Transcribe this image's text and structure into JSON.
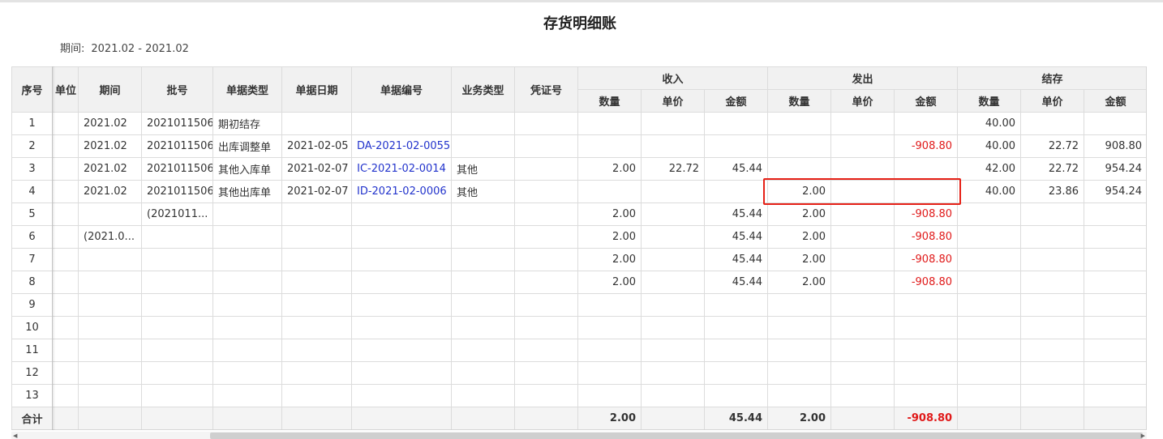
{
  "title": "存货明细账",
  "period": {
    "label": "期间:",
    "value": "2021.02 - 2021.02"
  },
  "headers": {
    "seq": "序号",
    "unit_partial": "单位",
    "period": "期间",
    "batch": "批号",
    "doc_type": "单据类型",
    "doc_date": "单据日期",
    "doc_no": "单据编号",
    "biz_type": "业务类型",
    "voucher": "凭证号",
    "in_group": "收入",
    "out_group": "发出",
    "bal_group": "结存",
    "qty": "数量",
    "price": "单价",
    "amount": "金额"
  },
  "rows": [
    {
      "seq": "1",
      "period": "2021.02",
      "batch": "2021011506",
      "doc_type": "期初结存",
      "doc_date": "",
      "doc_no": "",
      "biz_type": "",
      "voucher": "",
      "in_qty": "",
      "in_price": "",
      "in_amt": "",
      "out_qty": "",
      "out_price": "",
      "out_amt": "",
      "bal_qty": "40.00",
      "bal_price": "",
      "bal_amt": ""
    },
    {
      "seq": "2",
      "period": "2021.02",
      "batch": "2021011506",
      "doc_type": "出库调整单",
      "doc_date": "2021-02-05",
      "doc_no": "DA-2021-02-0055",
      "biz_type": "",
      "voucher": "",
      "in_qty": "",
      "in_price": "",
      "in_amt": "",
      "out_qty": "",
      "out_price": "",
      "out_amt": "-908.80",
      "bal_qty": "40.00",
      "bal_price": "22.72",
      "bal_amt": "908.80"
    },
    {
      "seq": "3",
      "period": "2021.02",
      "batch": "2021011506",
      "doc_type": "其他入库单",
      "doc_date": "2021-02-07",
      "doc_no": "IC-2021-02-0014",
      "biz_type": "其他",
      "voucher": "",
      "in_qty": "2.00",
      "in_price": "22.72",
      "in_amt": "45.44",
      "out_qty": "",
      "out_price": "",
      "out_amt": "",
      "bal_qty": "42.00",
      "bal_price": "22.72",
      "bal_amt": "954.24"
    },
    {
      "seq": "4",
      "period": "2021.02",
      "batch": "2021011506",
      "doc_type": "其他出库单",
      "doc_date": "2021-02-07",
      "doc_no": "ID-2021-02-0006",
      "biz_type": "其他",
      "voucher": "",
      "in_qty": "",
      "in_price": "",
      "in_amt": "",
      "out_qty": "2.00",
      "out_price": "",
      "out_amt": "",
      "bal_qty": "40.00",
      "bal_price": "23.86",
      "bal_amt": "954.24"
    },
    {
      "seq": "5",
      "period": "",
      "batch": "(2021011...",
      "doc_type": "",
      "doc_date": "",
      "doc_no": "",
      "biz_type": "",
      "voucher": "",
      "in_qty": "2.00",
      "in_price": "",
      "in_amt": "45.44",
      "out_qty": "2.00",
      "out_price": "",
      "out_amt": "-908.80",
      "bal_qty": "",
      "bal_price": "",
      "bal_amt": ""
    },
    {
      "seq": "6",
      "period": "(2021.0...",
      "batch": "",
      "doc_type": "",
      "doc_date": "",
      "doc_no": "",
      "biz_type": "",
      "voucher": "",
      "in_qty": "2.00",
      "in_price": "",
      "in_amt": "45.44",
      "out_qty": "2.00",
      "out_price": "",
      "out_amt": "-908.80",
      "bal_qty": "",
      "bal_price": "",
      "bal_amt": ""
    },
    {
      "seq": "7",
      "period": "",
      "batch": "",
      "doc_type": "",
      "doc_date": "",
      "doc_no": "",
      "biz_type": "",
      "voucher": "",
      "in_qty": "2.00",
      "in_price": "",
      "in_amt": "45.44",
      "out_qty": "2.00",
      "out_price": "",
      "out_amt": "-908.80",
      "bal_qty": "",
      "bal_price": "",
      "bal_amt": ""
    },
    {
      "seq": "8",
      "period": "",
      "batch": "",
      "doc_type": "",
      "doc_date": "",
      "doc_no": "",
      "biz_type": "",
      "voucher": "",
      "in_qty": "2.00",
      "in_price": "",
      "in_amt": "45.44",
      "out_qty": "2.00",
      "out_price": "",
      "out_amt": "-908.80",
      "bal_qty": "",
      "bal_price": "",
      "bal_amt": ""
    },
    {
      "seq": "9"
    },
    {
      "seq": "10"
    },
    {
      "seq": "11"
    },
    {
      "seq": "12"
    },
    {
      "seq": "13"
    }
  ],
  "total": {
    "label": "合计",
    "in_qty": "2.00",
    "in_amt": "45.44",
    "out_qty": "2.00",
    "out_amt": "-908.80"
  },
  "colors": {
    "negative": "#e01a1a",
    "link": "#2233cc",
    "highlight": "#e62117"
  }
}
